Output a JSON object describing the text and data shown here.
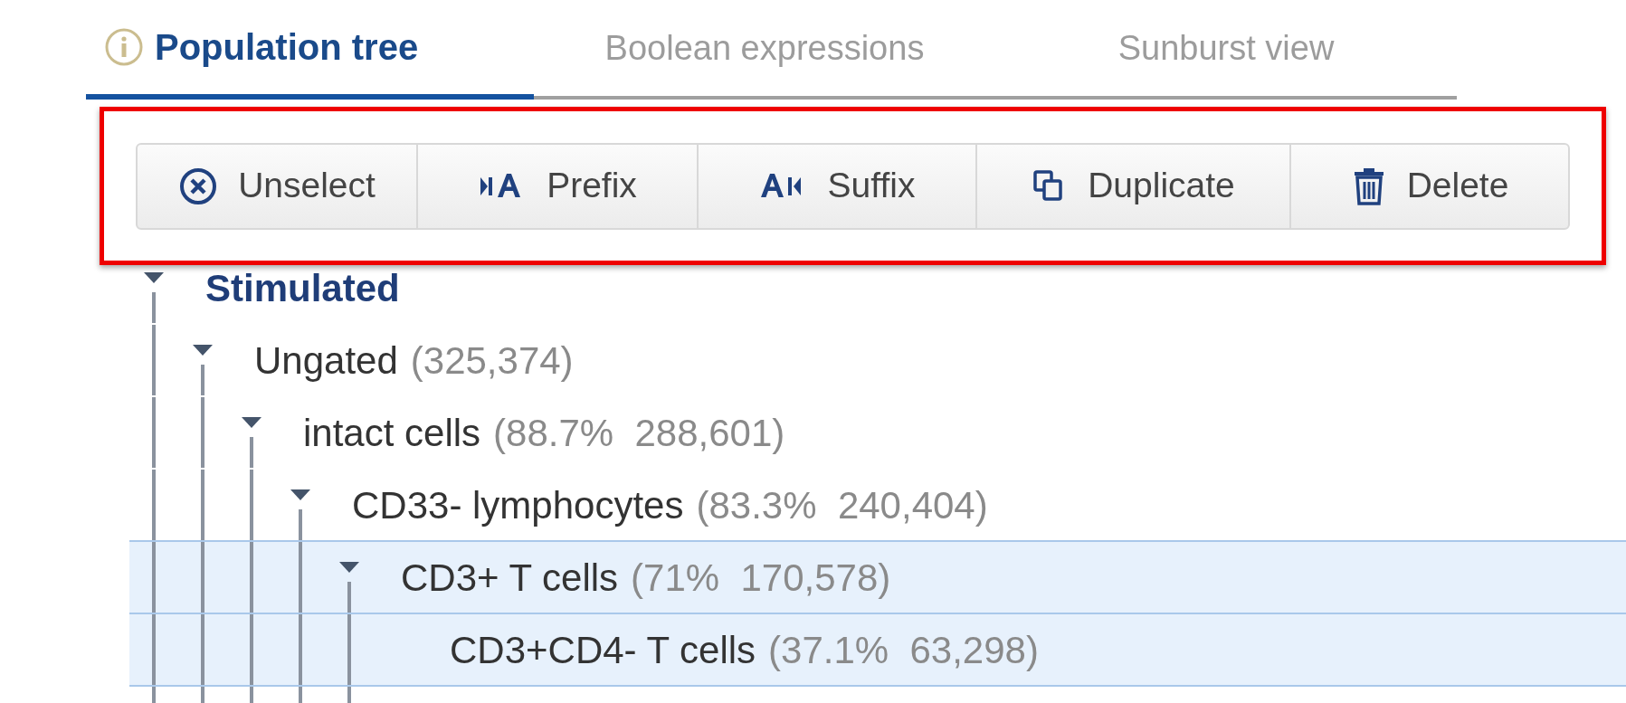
{
  "tabs": [
    {
      "label": "Population tree",
      "selected": true,
      "info": true
    },
    {
      "label": "Boolean expressions",
      "selected": false
    },
    {
      "label": "Sunburst view",
      "selected": false
    }
  ],
  "toolbar": [
    {
      "kind": "unselect",
      "label": "Unselect"
    },
    {
      "kind": "prefix",
      "label": "Prefix"
    },
    {
      "kind": "suffix",
      "label": "Suffix"
    },
    {
      "kind": "duplicate",
      "label": "Duplicate"
    },
    {
      "kind": "delete",
      "label": "Delete"
    }
  ],
  "tree": [
    {
      "kind": "sample",
      "label": "Stimulated",
      "expanded": true,
      "selected": false,
      "children": [
        {
          "kind": "gate",
          "label": "Ungated",
          "count": "(325,374)",
          "expanded": true,
          "selected": false,
          "children": [
            {
              "kind": "gate",
              "label": "intact cells",
              "count": "(88.7%  288,601)",
              "expanded": true,
              "selected": false,
              "children": [
                {
                  "kind": "gate",
                  "label": "CD33- lymphocytes",
                  "count": "(83.3%  240,404)",
                  "expanded": true,
                  "selected": false,
                  "children": [
                    {
                      "kind": "gate",
                      "label": "CD3+ T cells",
                      "count": "(71%  170,578)",
                      "expanded": true,
                      "selected": true,
                      "children": [
                        {
                          "kind": "gate",
                          "label": "CD3+CD4- T cells",
                          "count": "(37.1%  63,298)",
                          "expanded": false,
                          "selected": true
                        }
                      ]
                    }
                  ]
                }
              ]
            }
          ]
        }
      ]
    }
  ]
}
